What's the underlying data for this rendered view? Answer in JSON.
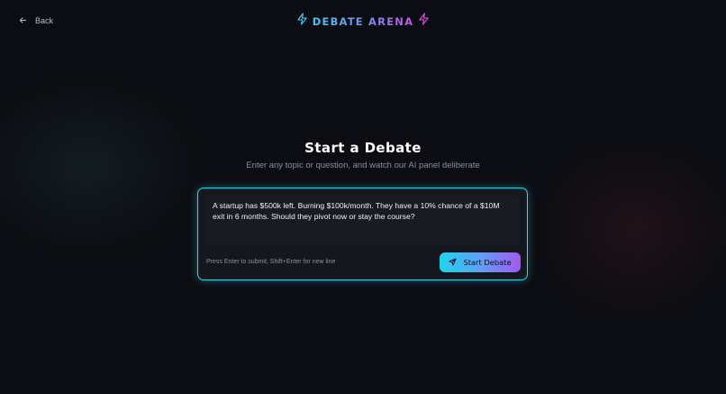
{
  "header": {
    "back_label": "Back",
    "brand": "DEBATE ARENA"
  },
  "main": {
    "title": "Start a Debate",
    "subtitle": "Enter any topic or question, and watch our AI panel deliberate"
  },
  "composer": {
    "value": "A startup has $500k left. Burning $100k/month. They have a 10% chance of a $10M exit in 6 months. Should they pivot now or stay the course?",
    "hint": "Press Enter to submit, Shift+Enter for new line",
    "submit_label": "Start Debate"
  },
  "icons": {
    "back": "arrow-left-icon",
    "brand_left": "lightning-icon",
    "brand_right": "lightning-icon",
    "submit": "send-icon"
  },
  "colors": {
    "accent_cyan": "#22d3ee",
    "accent_purple": "#a259f0",
    "brand_bolt_left": "#3fc8f0",
    "brand_bolt_right": "#d04fd8",
    "background": "#0c0d12"
  }
}
